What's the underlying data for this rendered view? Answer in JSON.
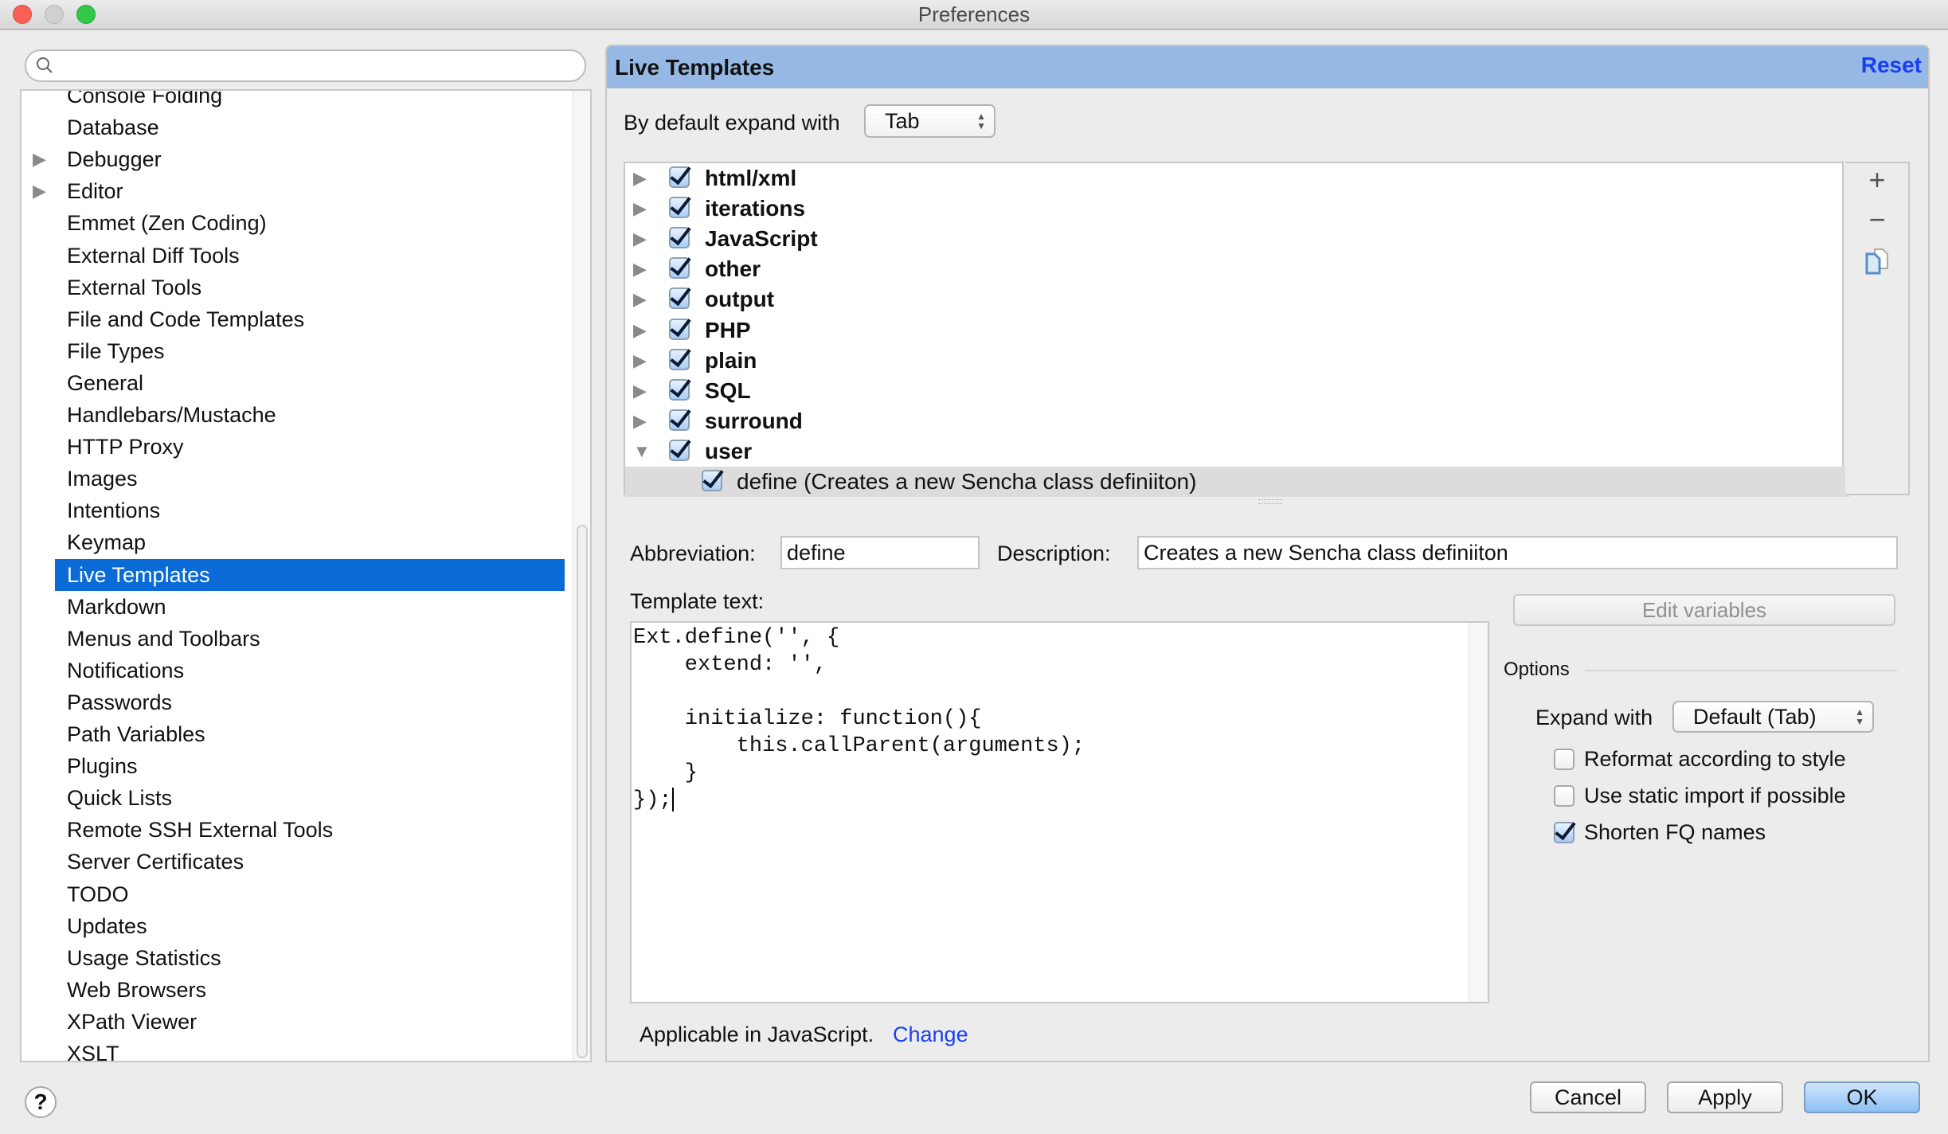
{
  "window": {
    "title": "Preferences"
  },
  "search": {
    "placeholder": "",
    "value": ""
  },
  "sidebar": {
    "items": [
      {
        "label": "Console Folding",
        "expandable": false
      },
      {
        "label": "Database",
        "expandable": false
      },
      {
        "label": "Debugger",
        "expandable": true
      },
      {
        "label": "Editor",
        "expandable": true
      },
      {
        "label": "Emmet (Zen Coding)",
        "expandable": false
      },
      {
        "label": "External Diff Tools",
        "expandable": false
      },
      {
        "label": "External Tools",
        "expandable": false
      },
      {
        "label": "File and Code Templates",
        "expandable": false
      },
      {
        "label": "File Types",
        "expandable": false
      },
      {
        "label": "General",
        "expandable": false
      },
      {
        "label": "Handlebars/Mustache",
        "expandable": false
      },
      {
        "label": "HTTP Proxy",
        "expandable": false
      },
      {
        "label": "Images",
        "expandable": false
      },
      {
        "label": "Intentions",
        "expandable": false
      },
      {
        "label": "Keymap",
        "expandable": false
      },
      {
        "label": "Live Templates",
        "expandable": false,
        "selected": true
      },
      {
        "label": "Markdown",
        "expandable": false
      },
      {
        "label": "Menus and Toolbars",
        "expandable": false
      },
      {
        "label": "Notifications",
        "expandable": false
      },
      {
        "label": "Passwords",
        "expandable": false
      },
      {
        "label": "Path Variables",
        "expandable": false
      },
      {
        "label": "Plugins",
        "expandable": false
      },
      {
        "label": "Quick Lists",
        "expandable": false
      },
      {
        "label": "Remote SSH External Tools",
        "expandable": false
      },
      {
        "label": "Server Certificates",
        "expandable": false
      },
      {
        "label": "TODO",
        "expandable": false
      },
      {
        "label": "Updates",
        "expandable": false
      },
      {
        "label": "Usage Statistics",
        "expandable": false
      },
      {
        "label": "Web Browsers",
        "expandable": false
      },
      {
        "label": "XPath Viewer",
        "expandable": false
      },
      {
        "label": "XSLT",
        "expandable": false
      }
    ]
  },
  "panel": {
    "title": "Live Templates",
    "reset_label": "Reset",
    "expand_label": "By default expand with",
    "expand_value": "Tab",
    "tree": [
      {
        "label": "html/xml",
        "checked": true,
        "expanded": false
      },
      {
        "label": "iterations",
        "checked": true,
        "expanded": false
      },
      {
        "label": "JavaScript",
        "checked": true,
        "expanded": false
      },
      {
        "label": "other",
        "checked": true,
        "expanded": false
      },
      {
        "label": "output",
        "checked": true,
        "expanded": false
      },
      {
        "label": "PHP",
        "checked": true,
        "expanded": false
      },
      {
        "label": "plain",
        "checked": true,
        "expanded": false
      },
      {
        "label": "SQL",
        "checked": true,
        "expanded": false
      },
      {
        "label": "surround",
        "checked": true,
        "expanded": false
      },
      {
        "label": "user",
        "checked": true,
        "expanded": true
      }
    ],
    "selected_template": {
      "label": "define (Creates a new Sencha class definiiton)",
      "checked": true
    },
    "tools": {
      "add": "+",
      "remove": "−",
      "copy": "copy-icon"
    },
    "abbreviation_label": "Abbreviation:",
    "abbreviation_value": "define",
    "description_label": "Description:",
    "description_value": "Creates a new Sencha class definiiton",
    "template_text_label": "Template text:",
    "template_text": "Ext.define('', {\n    extend: '',\n\n    initialize: function(){\n        this.callParent(arguments);\n    }\n});",
    "edit_variables_label": "Edit variables",
    "options": {
      "title": "Options",
      "expand_with_label": "Expand with",
      "expand_with_value": "Default (Tab)",
      "checkboxes": [
        {
          "label": "Reformat according to style",
          "checked": false
        },
        {
          "label": "Use static import if possible",
          "checked": false
        },
        {
          "label": "Shorten FQ names",
          "checked": true
        }
      ]
    },
    "applicable_text": "Applicable in JavaScript.",
    "change_label": "Change"
  },
  "footer": {
    "cancel": "Cancel",
    "apply": "Apply",
    "ok": "OK",
    "help": "?"
  }
}
